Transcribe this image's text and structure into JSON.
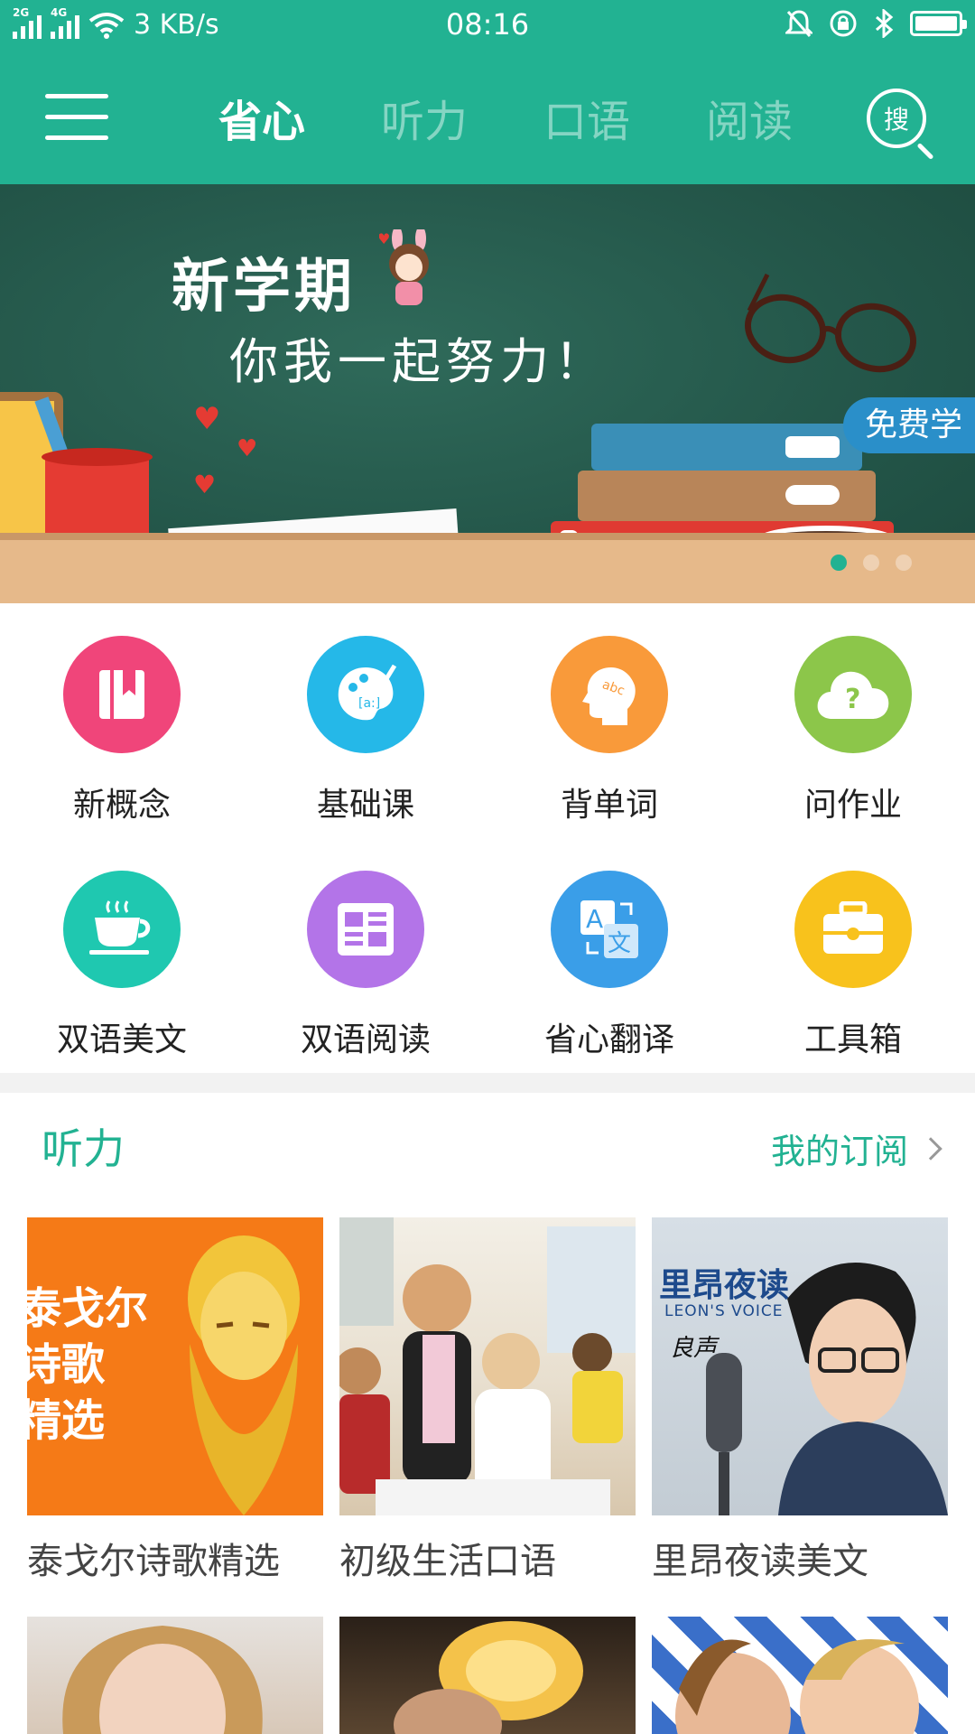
{
  "status_bar": {
    "net1": "2G",
    "net2": "4G",
    "speed": "3 KB/s",
    "time": "08:16"
  },
  "nav": {
    "tabs": [
      "省心",
      "听力",
      "口语",
      "阅读"
    ],
    "active_tab": 0,
    "search_label": "搜"
  },
  "banner": {
    "title": "新学期",
    "subtitle": "你我一起努力！",
    "badge": "免费学",
    "slides": 3,
    "active_slide": 0
  },
  "features": [
    {
      "label": "新概念",
      "icon": "book-icon",
      "color": "#f0457a"
    },
    {
      "label": "基础课",
      "icon": "palette-icon",
      "color": "#25b8e8"
    },
    {
      "label": "背单词",
      "icon": "head-abc-icon",
      "color": "#f99a3a"
    },
    {
      "label": "问作业",
      "icon": "question-cloud-icon",
      "color": "#8cc64a"
    },
    {
      "label": "双语美文",
      "icon": "tea-cup-icon",
      "color": "#1fc8b0"
    },
    {
      "label": "双语阅读",
      "icon": "newspaper-icon",
      "color": "#b374e8"
    },
    {
      "label": "省心翻译",
      "icon": "translate-icon",
      "color": "#3a9ee8"
    },
    {
      "label": "工具箱",
      "icon": "toolbox-icon",
      "color": "#f8c21c"
    }
  ],
  "listening": {
    "title": "听力",
    "subscribe_label": "我的订阅",
    "cards": [
      {
        "title": "泰戈尔诗歌精选",
        "cover_text": "泰戈尔\n诗歌\n精选"
      },
      {
        "title": "初级生活口语"
      },
      {
        "title": "里昂夜读美文",
        "cover_text": "里昂夜读",
        "cover_sub": "LEON'S VOICE",
        "cover_sign": "良声"
      }
    ]
  },
  "colors": {
    "primary": "#22b292",
    "section_divider": "#f2f2f2"
  }
}
